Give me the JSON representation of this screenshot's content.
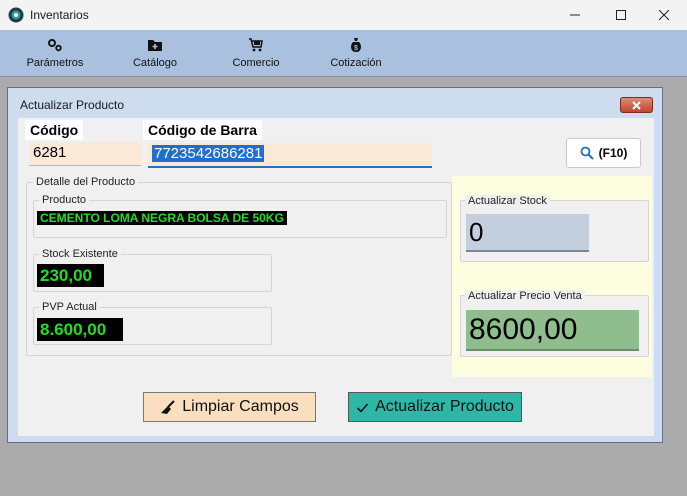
{
  "app": {
    "title": "Inventarios"
  },
  "menu": {
    "items": [
      {
        "label": "Parámetros",
        "icon": "gears-icon"
      },
      {
        "label": "Catálogo",
        "icon": "folder-plus-icon"
      },
      {
        "label": "Comercio",
        "icon": "cart-icon"
      },
      {
        "label": "Cotización",
        "icon": "money-bag-icon"
      }
    ]
  },
  "dialog": {
    "title": "Actualizar Producto",
    "codigo_label": "Código",
    "codigo_value": "6281",
    "barra_label": "Código de Barra",
    "barra_value": "7723542686281",
    "search_label": "(F10)",
    "detalle_legend": "Detalle del Producto",
    "producto_legend": "Producto",
    "producto_value": "CEMENTO LOMA NEGRA BOLSA DE 50KG",
    "stock_legend": "Stock Existente",
    "stock_value": "230,00",
    "pvp_legend": "PVP Actual",
    "pvp_value": "8.600,00",
    "actualizar_stock_legend": "Actualizar Stock",
    "actualizar_stock_value": "0",
    "actualizar_precio_legend": "Actualizar Precio Venta",
    "actualizar_precio_value": "8600,00",
    "limpiar_label": "Limpiar Campos",
    "actualizar_label": "Actualizar Producto"
  },
  "colors": {
    "menubar": "#a9c1de",
    "value_text": "#22dd22",
    "accent_button": "#2db7a6",
    "clear_button": "#f9dfbf",
    "price_field": "#8fbd8d"
  }
}
